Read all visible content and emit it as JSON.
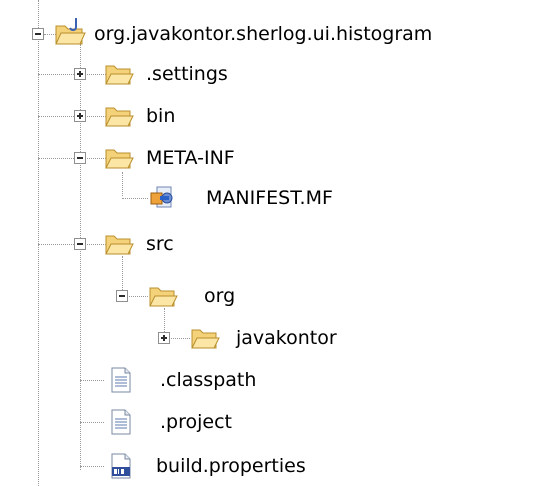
{
  "tree": {
    "items": [
      {
        "label": "org.javakontor.sherlog.ui.histogram",
        "icon": "java-project-folder-icon",
        "expanded": true
      },
      {
        "label": ".settings",
        "icon": "folder-icon",
        "expanded": false
      },
      {
        "label": "bin",
        "icon": "folder-icon",
        "expanded": false
      },
      {
        "label": "META-INF",
        "icon": "folder-icon",
        "expanded": true
      },
      {
        "label": "MANIFEST.MF",
        "icon": "manifest-file-icon"
      },
      {
        "label": "src",
        "icon": "folder-icon",
        "expanded": true
      },
      {
        "label": "org",
        "icon": "folder-icon",
        "expanded": true
      },
      {
        "label": "javakontor",
        "icon": "folder-icon",
        "expanded": false
      },
      {
        "label": ".classpath",
        "icon": "text-file-icon"
      },
      {
        "label": ".project",
        "icon": "text-file-icon"
      },
      {
        "label": "build.properties",
        "icon": "properties-file-icon"
      }
    ]
  }
}
